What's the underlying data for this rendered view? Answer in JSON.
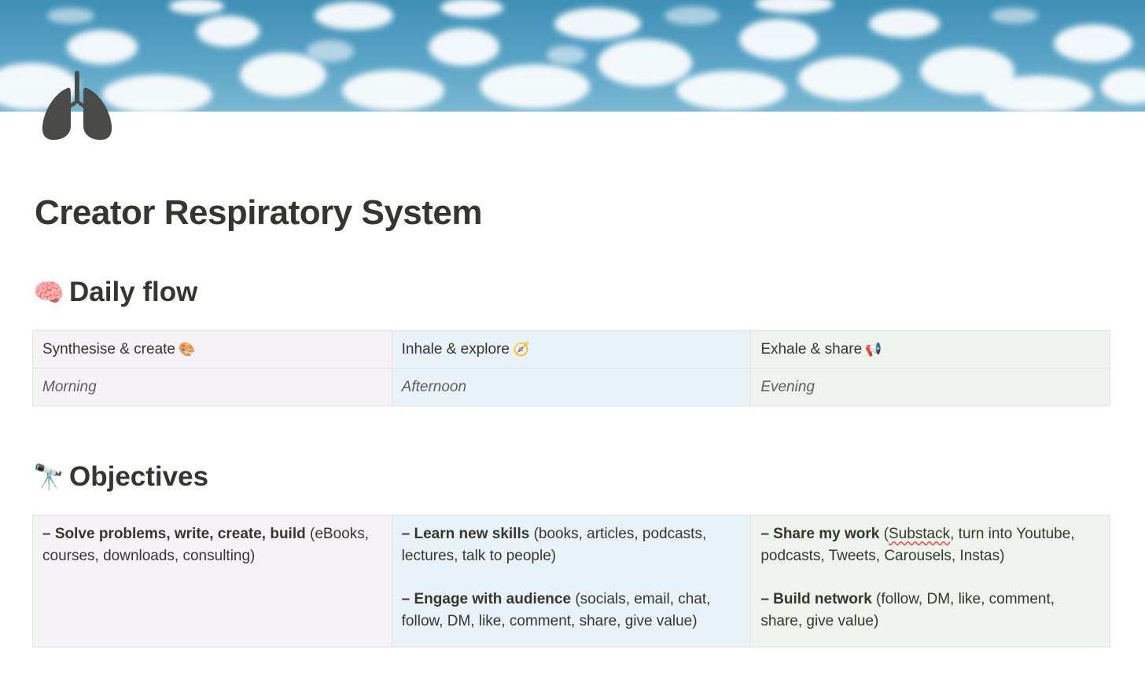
{
  "page": {
    "title": "Creator Respiratory System",
    "icon": "lungs-icon"
  },
  "daily_flow": {
    "heading_emoji": "🧠",
    "heading": "Daily flow",
    "columns": [
      {
        "label": "Synthesise & create",
        "emoji": "🎨",
        "time": "Morning",
        "color": "#f6f3f8"
      },
      {
        "label": "Inhale & explore",
        "emoji": "🧭",
        "time": "Afternoon",
        "color": "#e8f2f8"
      },
      {
        "label": "Exhale & share",
        "emoji": "📢",
        "time": "Evening",
        "color": "#eef3ed"
      }
    ]
  },
  "objectives": {
    "heading_emoji": "🔭",
    "heading": "Objectives",
    "columns": [
      {
        "items": [
          {
            "bold": "– Solve problems, write, create, build",
            "rest": " (eBooks, courses, downloads, consulting)"
          }
        ]
      },
      {
        "items": [
          {
            "bold": "– Learn new skills",
            "rest": " (books, articles, podcasts, lectures, talk to people)"
          },
          {
            "bold": "– Engage with audience",
            "rest": " (socials, email, chat, follow, DM, like, comment, share, give value)"
          }
        ]
      },
      {
        "items": [
          {
            "bold": "– Share my work",
            "pre": " (",
            "flagged": "Substack",
            "rest": ", turn into Youtube, podcasts, Tweets, Carousels, Instas)"
          },
          {
            "bold": "– Build network",
            "rest": " (follow, DM, like, comment, share, give value)"
          }
        ]
      }
    ]
  }
}
